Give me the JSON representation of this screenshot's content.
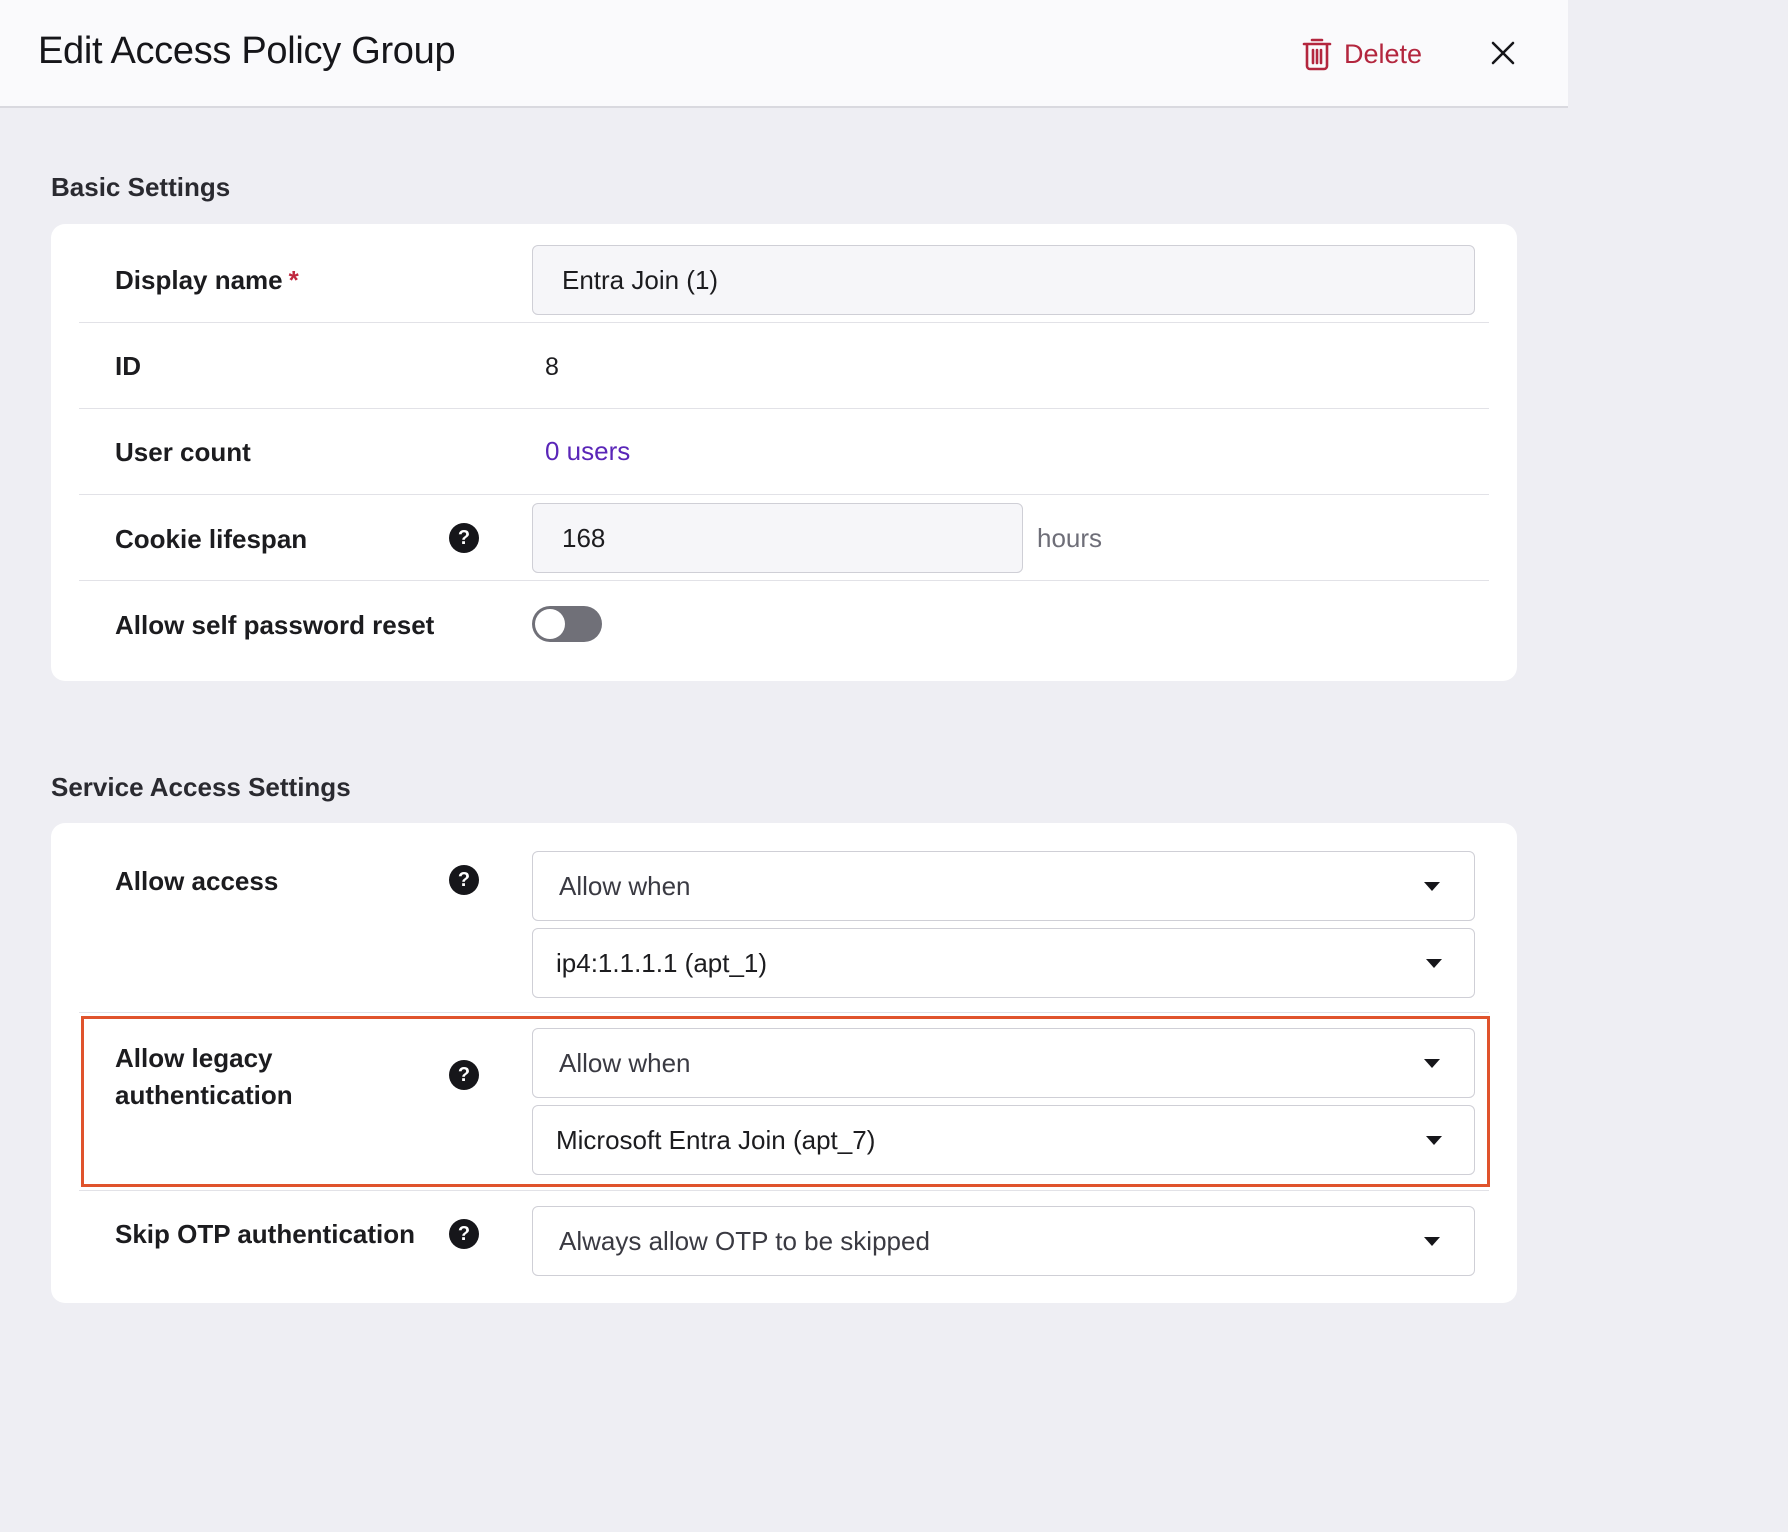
{
  "header": {
    "title": "Edit Access Policy Group",
    "delete_label": "Delete"
  },
  "basic": {
    "section_title": "Basic Settings",
    "display_name_label": "Display name",
    "required_mark": "*",
    "display_name_value": "Entra Join (1)",
    "id_label": "ID",
    "id_value": "8",
    "user_count_label": "User count",
    "user_count_value": "0 users",
    "cookie_label": "Cookie lifespan",
    "cookie_value": "168",
    "cookie_unit": "hours",
    "self_reset_label": "Allow self password reset",
    "self_reset_on": false
  },
  "service": {
    "section_title": "Service Access Settings",
    "allow_access_label": "Allow access",
    "allow_access_mode": "Allow when",
    "allow_access_condition": "ip4:1.1.1.1 (apt_1)",
    "legacy_label_line1": "Allow legacy",
    "legacy_label_line2": "authentication",
    "legacy_mode": "Allow when",
    "legacy_condition": "Microsoft Entra Join (apt_7)",
    "skip_otp_label": "Skip OTP authentication",
    "skip_otp_value": "Always allow OTP to be skipped"
  },
  "icons": {
    "help": "?",
    "delete": "trash-icon",
    "close": "close-icon",
    "dropdown": "caret-down-icon"
  },
  "colors": {
    "accent_link": "#5a26b8",
    "danger": "#b3263e",
    "highlight": "#e0532c",
    "toggle_off": "#707078"
  }
}
